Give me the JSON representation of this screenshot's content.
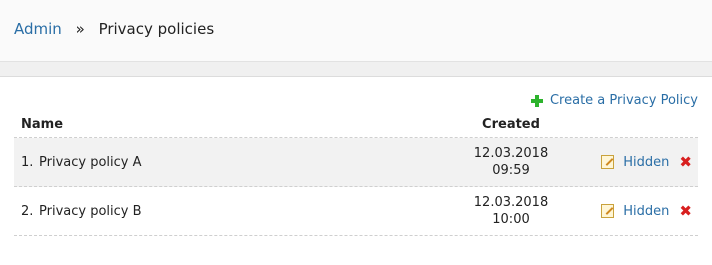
{
  "breadcrumb": {
    "root": "Admin",
    "separator": "»",
    "current": "Privacy policies"
  },
  "toolbar": {
    "create_label": "Create a Privacy Policy",
    "create_icon": "plus-icon",
    "accent_color": "#2db32d"
  },
  "table": {
    "headers": {
      "name": "Name",
      "created": "Created"
    },
    "rows": [
      {
        "index": "1.",
        "name": "Privacy policy A",
        "date": "12.03.2018",
        "time": "09:59",
        "status": "Hidden"
      },
      {
        "index": "2.",
        "name": "Privacy policy B",
        "date": "12.03.2018",
        "time": "10:00",
        "status": "Hidden"
      }
    ]
  },
  "colors": {
    "link": "#2a6ea6",
    "delete": "#d81f1f"
  }
}
